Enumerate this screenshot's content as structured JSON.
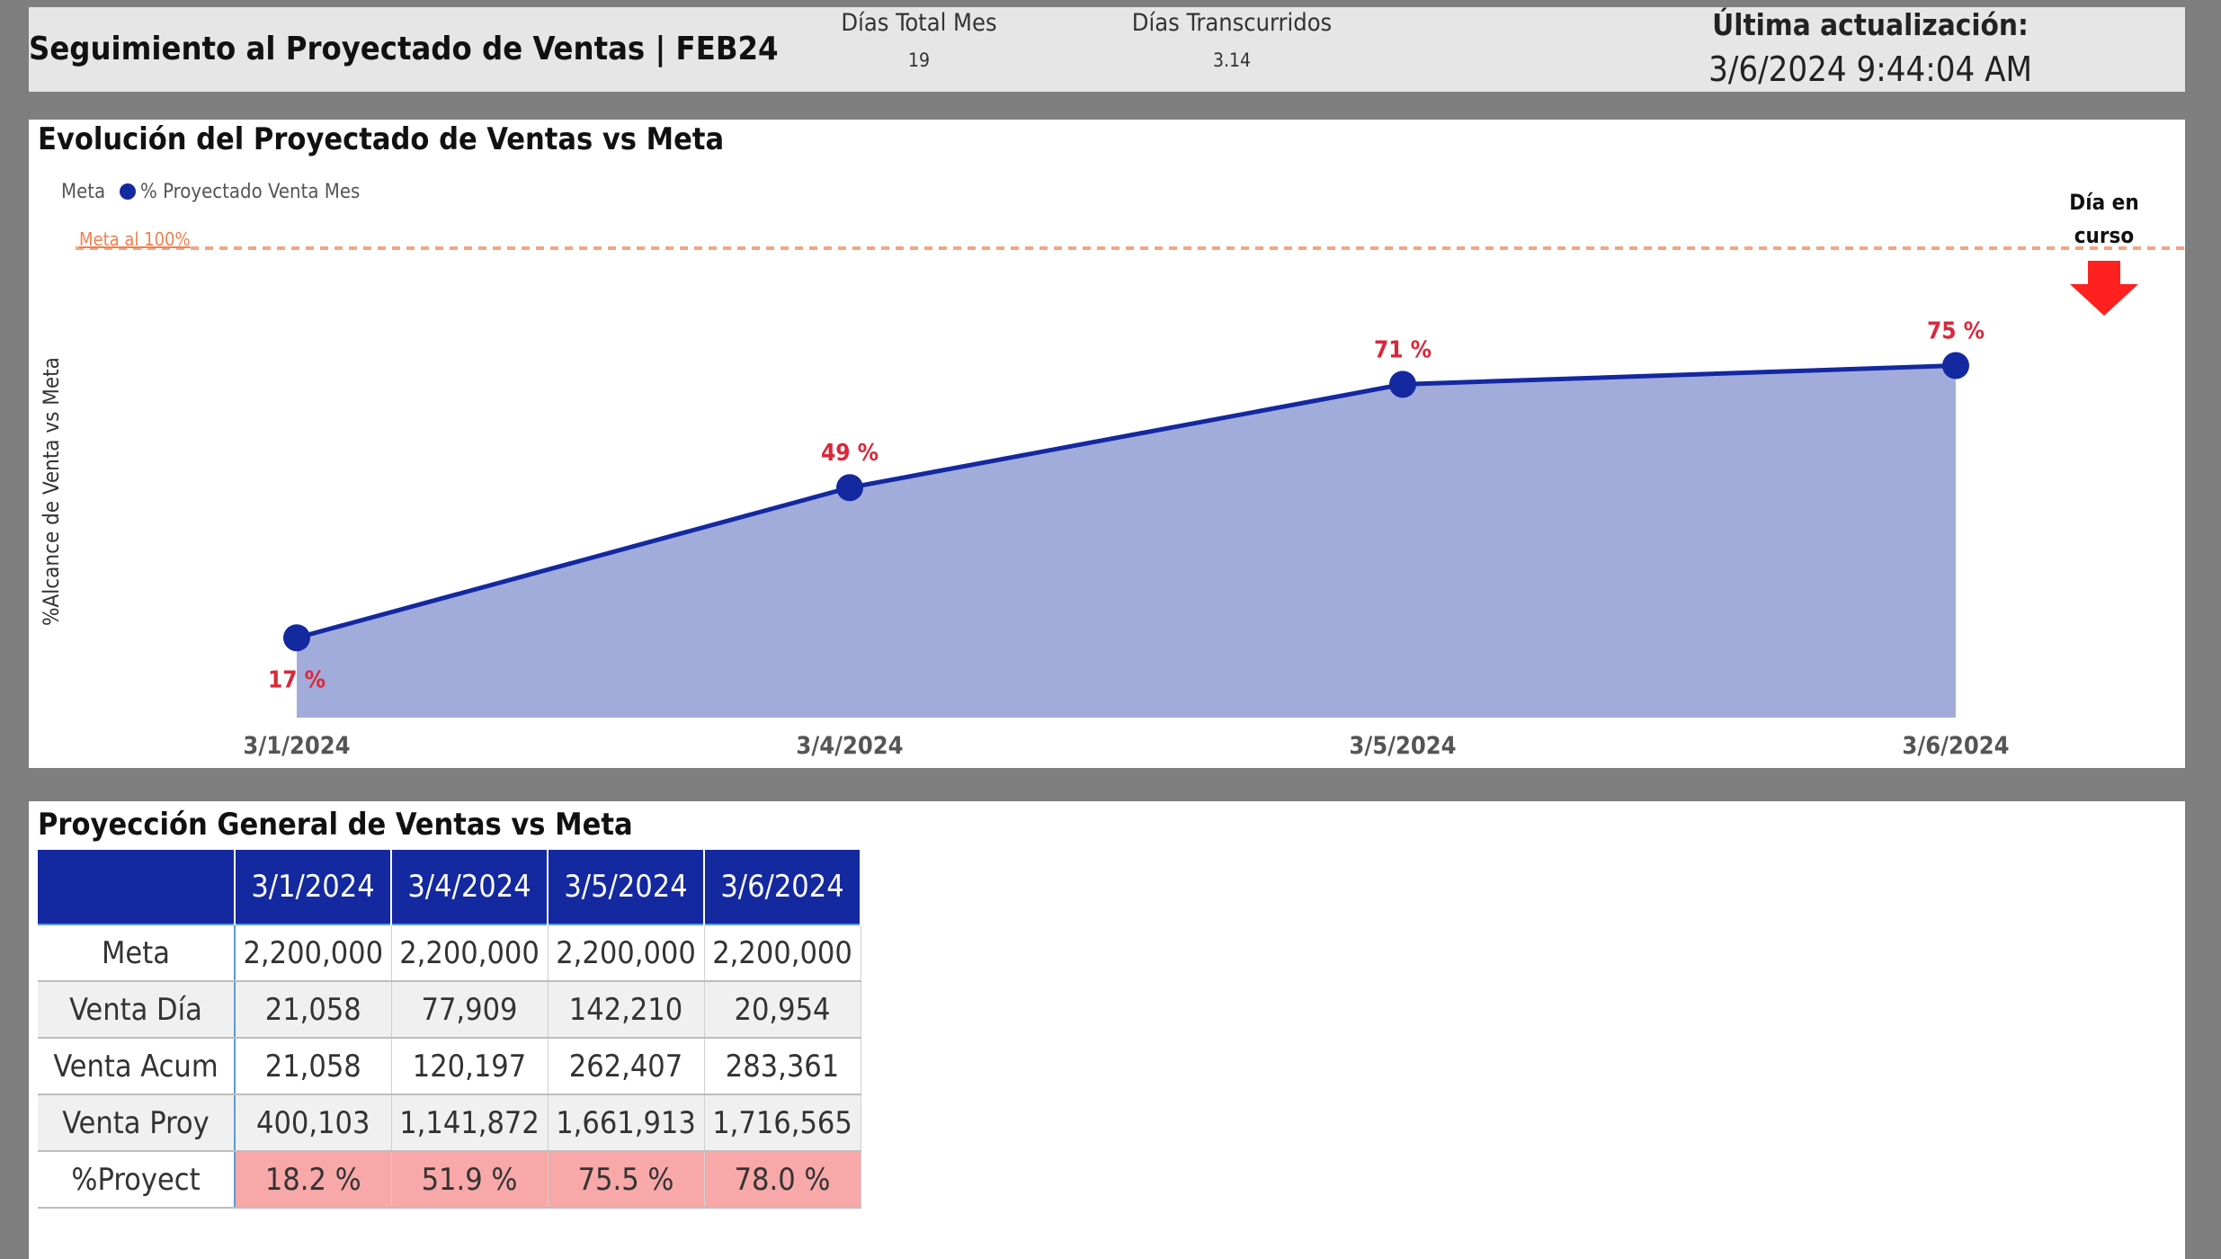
{
  "header": {
    "title": "Seguimiento al Proyectado de Ventas | FEB24",
    "dias_total_label": "Días Total Mes",
    "dias_total_value": "19",
    "dias_trans_label": "Días Transcurridos",
    "dias_trans_value": "3.14",
    "update_label": "Última actualización:",
    "update_value": "3/6/2024 9:44:04 AM"
  },
  "chart_panel": {
    "title": "Evolución del Proyectado de Ventas vs Meta",
    "legend_meta": "Meta",
    "legend_series": "% Proyectado Venta Mes",
    "meta_line_label": "Meta al 100%",
    "current_day_label_line1": "Día en",
    "current_day_label_line2": "curso"
  },
  "chart_data": {
    "type": "area",
    "title": "Evolución del Proyectado de Ventas vs Meta",
    "ylabel": "%Alcance de Venta vs Meta",
    "xlabel": "",
    "categories": [
      "3/1/2024",
      "3/4/2024",
      "3/5/2024",
      "3/6/2024"
    ],
    "series": [
      {
        "name": "% Proyectado Venta Mes",
        "values": [
          17,
          49,
          71,
          75
        ],
        "labels": [
          "17 %",
          "49 %",
          "71 %",
          "75 %"
        ]
      }
    ],
    "reference_line": {
      "name": "Meta",
      "value": 100,
      "label": "Meta al 100%"
    },
    "ylim": [
      0,
      100
    ],
    "legend_position": "top-left",
    "grid": false,
    "colors": {
      "line": "#1428a0",
      "fill": "#a2acdb",
      "marker": "#1428a0",
      "labels": "#d9283a",
      "reference": "#f4a582"
    }
  },
  "table_panel": {
    "title": "Proyección General de Ventas vs Meta",
    "columns": [
      "3/1/2024",
      "3/4/2024",
      "3/5/2024",
      "3/6/2024"
    ],
    "rows": [
      {
        "label": "Meta",
        "values": [
          "2,200,000",
          "2,200,000",
          "2,200,000",
          "2,200,000"
        ]
      },
      {
        "label": "Venta Día",
        "values": [
          "21,058",
          "77,909",
          "142,210",
          "20,954"
        ]
      },
      {
        "label": "Venta Acum",
        "values": [
          "21,058",
          "120,197",
          "262,407",
          "283,361"
        ]
      },
      {
        "label": "Venta Proy",
        "values": [
          "400,103",
          "1,141,872",
          "1,661,913",
          "1,716,565"
        ]
      },
      {
        "label": "%Proyect",
        "values": [
          "18.2 %",
          "51.9 %",
          "75.5 %",
          "78.0 %"
        ]
      }
    ]
  },
  "colors": {
    "background": "#7f7f7f",
    "header_bg": "#e6e6e6",
    "table_header_bg": "#1428a0",
    "highlight_row": "#f8a8a8",
    "arrow": "#ff2020"
  }
}
